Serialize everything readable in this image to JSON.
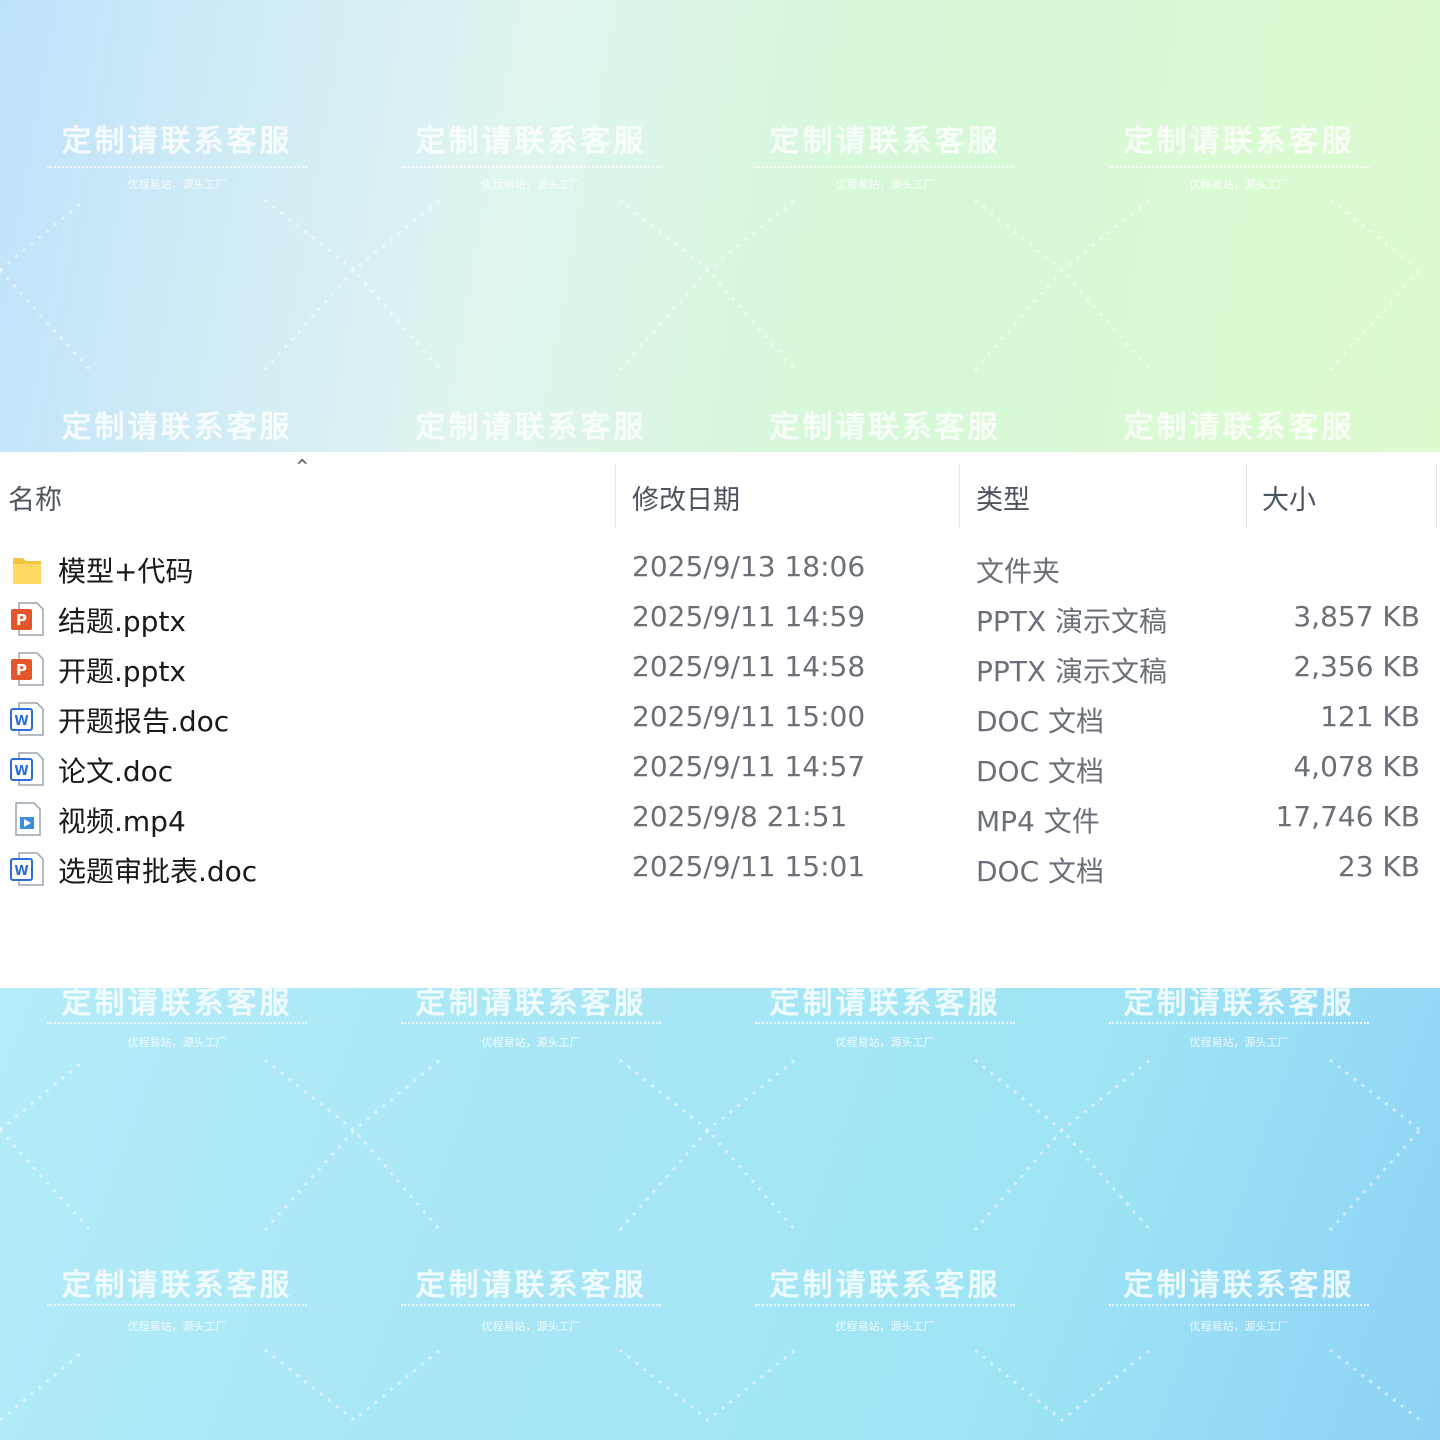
{
  "watermark": {
    "main": "定制请联系客服",
    "sub": "优程易站，源头工厂"
  },
  "columns": {
    "name": "名称",
    "date": "修改日期",
    "type": "类型",
    "size": "大小"
  },
  "sort": {
    "column": "name",
    "direction": "ascending",
    "icon": "chevron-up-icon"
  },
  "files": [
    {
      "name": "模型+代码",
      "date": "2025/9/13 18:06",
      "type": "文件夹",
      "size": "",
      "icon": "folder-icon"
    },
    {
      "name": "结题.pptx",
      "date": "2025/9/11 14:59",
      "type": "PPTX 演示文稿",
      "size": "3,857 KB",
      "icon": "powerpoint-icon"
    },
    {
      "name": "开题.pptx",
      "date": "2025/9/11 14:58",
      "type": "PPTX 演示文稿",
      "size": "2,356 KB",
      "icon": "powerpoint-icon"
    },
    {
      "name": "开题报告.doc",
      "date": "2025/9/11 15:00",
      "type": "DOC 文档",
      "size": "121 KB",
      "icon": "word-icon"
    },
    {
      "name": "论文.doc",
      "date": "2025/9/11 14:57",
      "type": "DOC 文档",
      "size": "4,078 KB",
      "icon": "word-icon"
    },
    {
      "name": "视频.mp4",
      "date": "2025/9/8 21:51",
      "type": "MP4 文件",
      "size": "17,746 KB",
      "icon": "video-icon"
    },
    {
      "name": "选题审批表.doc",
      "date": "2025/9/11 15:01",
      "type": "DOC 文档",
      "size": "23 KB",
      "icon": "word-icon"
    }
  ]
}
